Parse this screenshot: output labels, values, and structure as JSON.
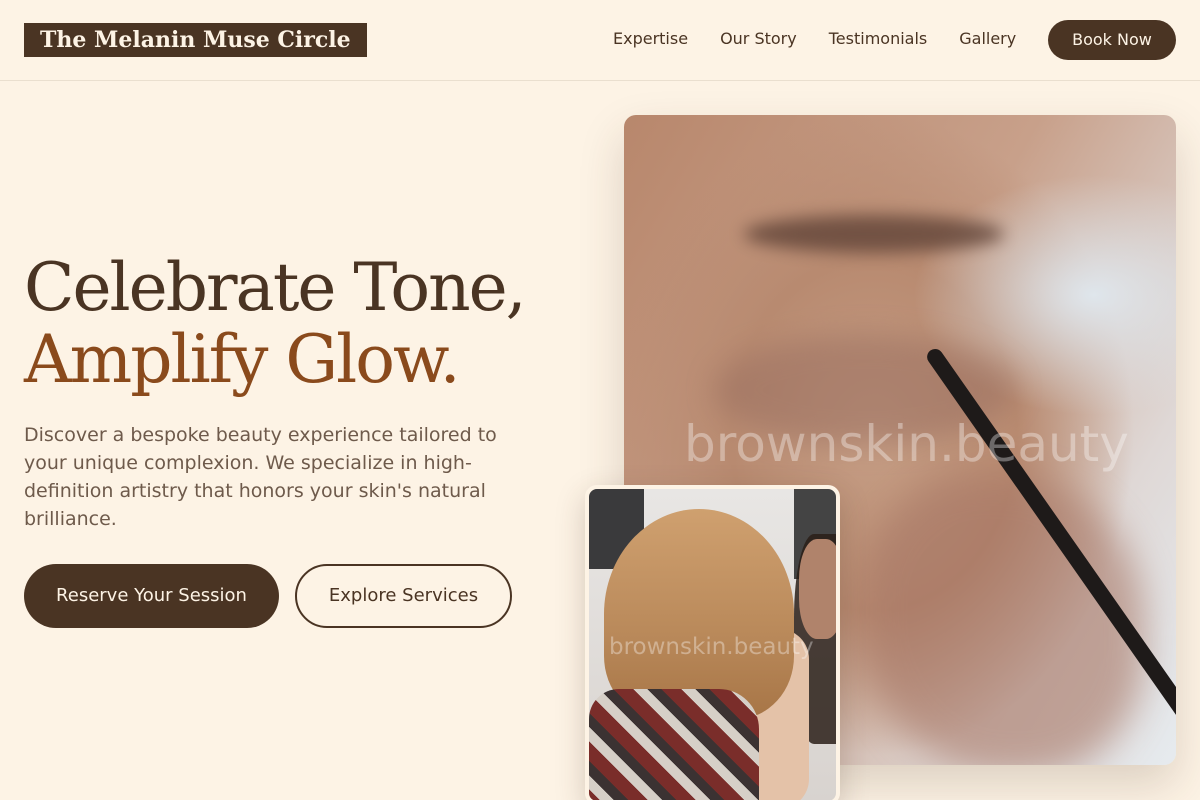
{
  "brand": {
    "name": "The Melanin Muse Circle"
  },
  "nav": {
    "items": [
      {
        "label": "Expertise"
      },
      {
        "label": "Our Story"
      },
      {
        "label": "Testimonials"
      },
      {
        "label": "Gallery"
      }
    ],
    "cta_label": "Book Now"
  },
  "hero": {
    "headline_line1": "Celebrate Tone,",
    "headline_line2": "Amplify Glow.",
    "description": "Discover a bespoke beauty experience tailored to your unique complexion. We specialize in high-definition artistry that honors your skin's natural brilliance.",
    "primary_cta": "Reserve Your Session",
    "secondary_cta": "Explore Services"
  },
  "images": {
    "main_watermark": "brownskin.beauty",
    "secondary_watermark": "brownskin.beauty"
  },
  "colors": {
    "background": "#fdf3e5",
    "primary_brown": "#4a3423",
    "accent_copper": "#8a4a1c",
    "body_text": "#6e5a4b"
  }
}
